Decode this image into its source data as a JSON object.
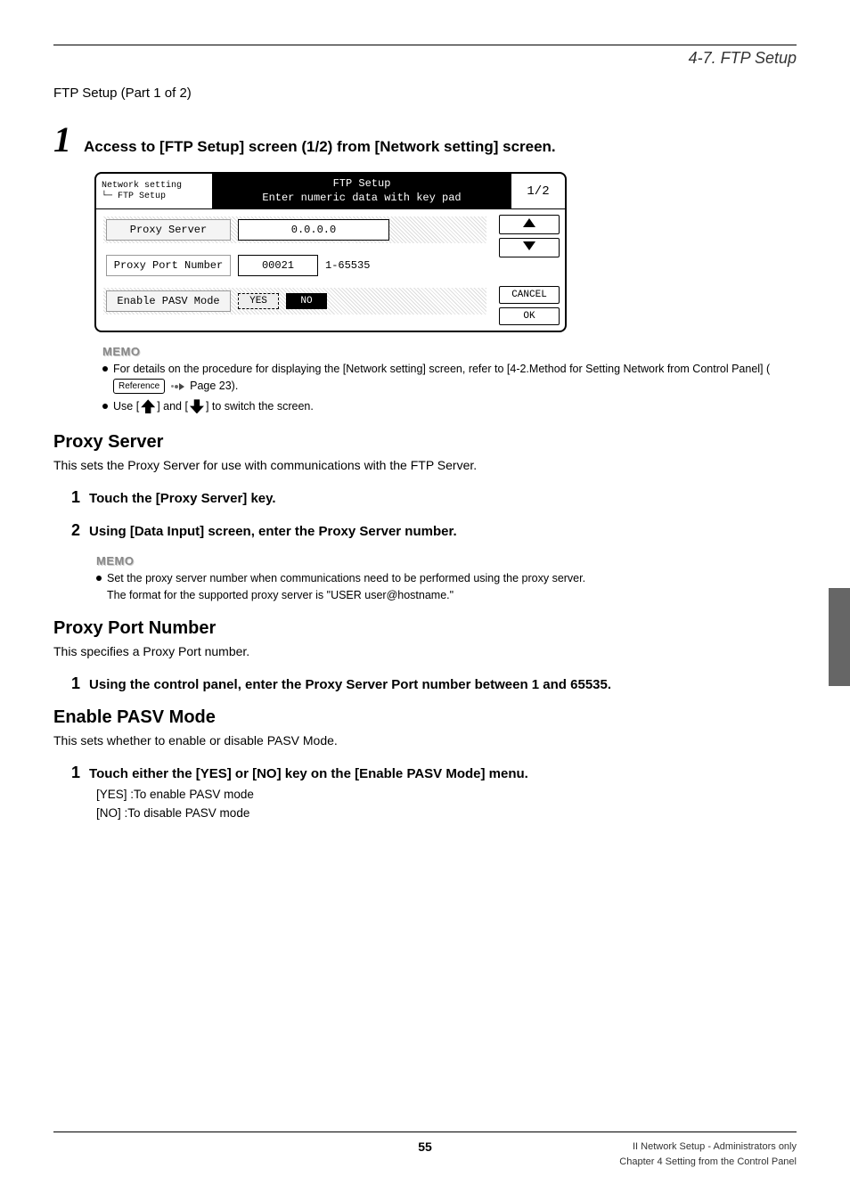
{
  "header": {
    "section": "4-7. FTP Setup"
  },
  "part_label": "FTP Setup (Part 1 of 2)",
  "step1": {
    "num": "1",
    "heading": "Access to [FTP Setup] screen (1/2) from [Network setting] screen."
  },
  "screen": {
    "crumb1": "Network setting",
    "crumb2": "└─ FTP Setup",
    "title_line1": "FTP Setup",
    "title_line2": "Enter numeric data with key pad",
    "page": "1/2",
    "proxy_server_label": "Proxy Server",
    "proxy_server_value": "0.0.0.0",
    "proxy_port_label": "Proxy Port Number",
    "proxy_port_value": "00021",
    "proxy_port_range": "1-65535",
    "pasv_label": "Enable PASV Mode",
    "pasv_yes": "YES",
    "pasv_no": "NO",
    "btn_cancel": "CANCEL",
    "btn_ok": "OK"
  },
  "memo1": {
    "label": "MEMO",
    "line1a": "For details on the procedure for displaying the [Network setting] screen, refer to [4-2.Method for Setting Network from Control Panel] (",
    "ref": "Reference",
    "line1b": " Page 23).",
    "line2a": "Use [",
    "line2b": "] and [",
    "line2c": "] to switch the screen."
  },
  "proxy_server": {
    "title": "Proxy Server",
    "desc": "This sets the Proxy Server for use with communications with the FTP Server.",
    "s1": {
      "num": "1",
      "text": "Touch the [Proxy Server] key."
    },
    "s2": {
      "num": "2",
      "text": "Using [Data Input] screen, enter the Proxy Server number."
    },
    "memo_label": "MEMO",
    "memo_line1": "Set the proxy server number when communications need to be performed using the proxy server.",
    "memo_line2": "The format for the supported proxy server is \"USER user@hostname.\""
  },
  "proxy_port": {
    "title": "Proxy Port Number",
    "desc": "This specifies a Proxy Port number.",
    "s1": {
      "num": "1",
      "text": "Using the control panel, enter the Proxy Server Port number between 1 and 65535."
    }
  },
  "pasv": {
    "title": "Enable PASV Mode",
    "desc": "This sets whether to enable or disable PASV Mode.",
    "s1": {
      "num": "1",
      "text": "Touch either the [YES] or [NO] key on the [Enable PASV Mode] menu."
    },
    "opt_yes": "[YES]  :To enable PASV mode",
    "opt_no": "[NO]   :To disable PASV mode"
  },
  "footer": {
    "page": "55",
    "right1": "II Network Setup - Administrators only",
    "right2": "Chapter 4 Setting from the Control Panel"
  }
}
